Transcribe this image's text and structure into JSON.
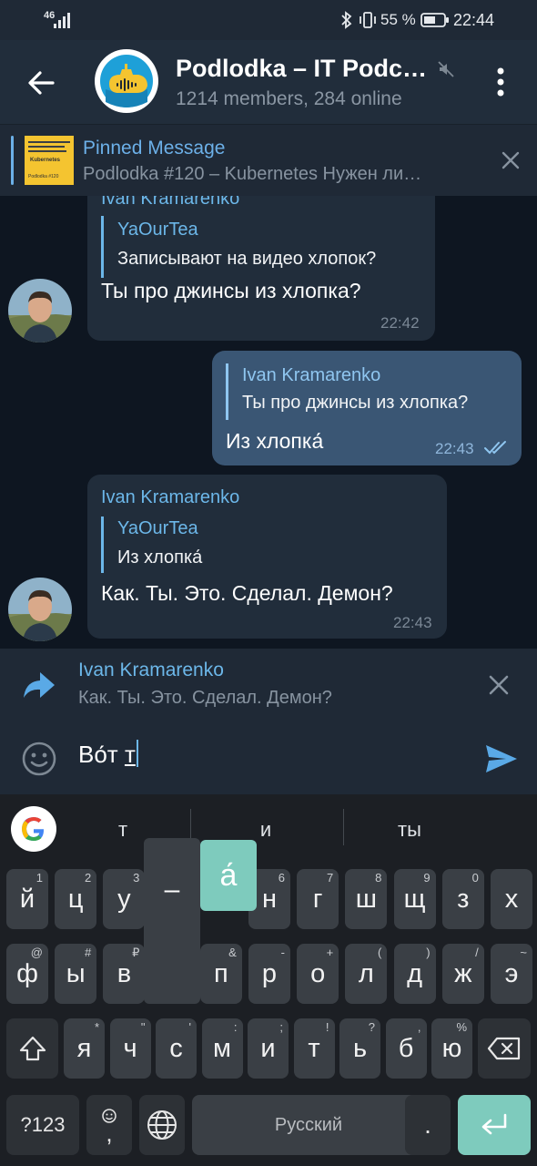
{
  "status_bar": {
    "signal": "46",
    "battery_percent": "55 %",
    "time": "22:44"
  },
  "header": {
    "title": "Podlodka – IT Podc…",
    "subtitle": "1214 members, 284 online",
    "back_icon": "arrow-left-icon",
    "mute_icon": "mute-icon",
    "menu_icon": "more-vertical-icon"
  },
  "pinned": {
    "title": "Pinned Message",
    "preview": "Podlodka #120 – Kubernetes  Нужен ли…",
    "thumb_lines": [
      "Podlodka #120",
      "Kubernetes"
    ]
  },
  "messages": [
    {
      "sender": "Ivan Kramarenko",
      "reply_to_name": "YaOurTea",
      "reply_to_text": "Записывают на видео хлопок?",
      "text": "Ты про джинсы из хлопка?",
      "time": "22:42"
    },
    {
      "reply_to_name": "Ivan Kramarenko",
      "reply_to_text": "Ты про джинсы из хлопка?",
      "text": "Из хлопка́",
      "time": "22:43"
    },
    {
      "sender": "Ivan Kramarenko",
      "reply_to_name": "YaOurTea",
      "reply_to_text": "Из хлопка́",
      "text": "Как. Ты. Это. Сделал. Демон?",
      "time": "22:43"
    }
  ],
  "reply_panel": {
    "name": "Ivan Kramarenko",
    "text": "Как. Ты. Это. Сделал. Демон?"
  },
  "input": {
    "value_before_cursor": "Во́т ",
    "underlined_word": "т"
  },
  "keyboard": {
    "suggestions": [
      "т",
      "и",
      "ты"
    ],
    "popup": {
      "dash": "–",
      "accent": "а́"
    },
    "row1": [
      {
        "k": "й",
        "h": "1"
      },
      {
        "k": "ц",
        "h": "2"
      },
      {
        "k": "у",
        "h": "3"
      },
      {
        "k": "",
        "h": ""
      },
      {
        "k": "",
        "h": ""
      },
      {
        "k": "н",
        "h": "6"
      },
      {
        "k": "г",
        "h": "7"
      },
      {
        "k": "ш",
        "h": "8"
      },
      {
        "k": "щ",
        "h": "9"
      },
      {
        "k": "з",
        "h": "0"
      },
      {
        "k": "х",
        "h": ""
      }
    ],
    "row2": [
      {
        "k": "ф",
        "h": "@"
      },
      {
        "k": "ы",
        "h": "#"
      },
      {
        "k": "в",
        "h": "₽"
      },
      {
        "k": "",
        "h": ""
      },
      {
        "k": "п",
        "h": "&"
      },
      {
        "k": "р",
        "h": "-"
      },
      {
        "k": "о",
        "h": "+"
      },
      {
        "k": "л",
        "h": "("
      },
      {
        "k": "д",
        "h": ")"
      },
      {
        "k": "ж",
        "h": "/"
      },
      {
        "k": "э",
        "h": "~"
      }
    ],
    "row3": [
      {
        "k": "я",
        "h": "*"
      },
      {
        "k": "ч",
        "h": "\""
      },
      {
        "k": "с",
        "h": "'"
      },
      {
        "k": "м",
        "h": ":"
      },
      {
        "k": "и",
        "h": ";"
      },
      {
        "k": "т",
        "h": "!"
      },
      {
        "k": "ь",
        "h": "?"
      },
      {
        "k": "б",
        "h": ","
      },
      {
        "k": "ю",
        "h": "%"
      }
    ],
    "symbols_label": "?123",
    "emoji_comma": ",",
    "space_label": "Русский",
    "period": "."
  }
}
